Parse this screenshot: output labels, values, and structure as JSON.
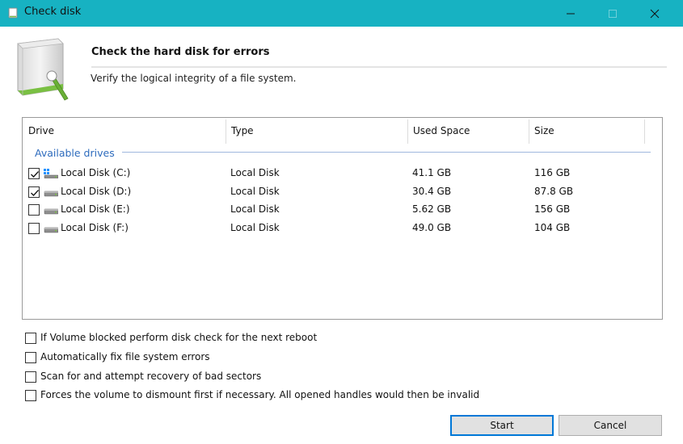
{
  "window": {
    "title": "Check disk"
  },
  "header": {
    "title": "Check the hard disk for errors",
    "subtitle": "Verify the logical integrity of a file system."
  },
  "list": {
    "columns": [
      "Drive",
      "Type",
      "Used Space",
      "Size"
    ],
    "group_label": "Available drives",
    "rows": [
      {
        "drive": "Local Disk (C:)",
        "type": "Local Disk",
        "used": "41.1 GB",
        "size": "116 GB",
        "checked": true,
        "icon": "system-drive-icon"
      },
      {
        "drive": "Local Disk (D:)",
        "type": "Local Disk",
        "used": "30.4 GB",
        "size": "87.8 GB",
        "checked": true,
        "icon": "hard-drive-icon"
      },
      {
        "drive": "Local Disk (E:)",
        "type": "Local Disk",
        "used": "5.62 GB",
        "size": "156 GB",
        "checked": false,
        "icon": "hard-drive-icon"
      },
      {
        "drive": "Local Disk (F:)",
        "type": "Local Disk",
        "used": "49.0 GB",
        "size": "104 GB",
        "checked": false,
        "icon": "hard-drive-icon"
      }
    ]
  },
  "options": [
    {
      "label": "If Volume blocked perform disk check for the next reboot",
      "checked": false
    },
    {
      "label": "Automatically fix file system errors",
      "checked": false
    },
    {
      "label": "Scan for and attempt recovery of bad sectors",
      "checked": false
    },
    {
      "label": "Forces the volume to dismount first if necessary. All opened handles would then be invalid",
      "checked": false
    }
  ],
  "buttons": {
    "start": "Start",
    "cancel": "Cancel"
  },
  "colors": {
    "titlebar": "#17b2c2",
    "accent": "#0078d7",
    "group_label": "#2d6bbd"
  }
}
